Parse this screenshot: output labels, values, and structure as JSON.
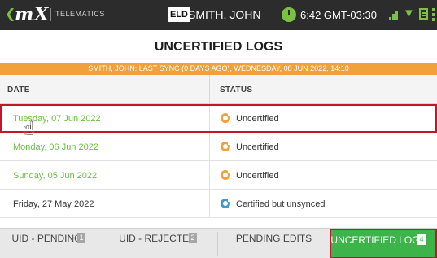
{
  "topbar": {
    "back_icon": "chevron-left-icon",
    "logo_m": "m",
    "logo_x": "X",
    "telematics": "TELEMATICS",
    "eld_badge": "ELD",
    "driver_name": "SMITH, JOHN",
    "time": "6:42 GMT-03:30",
    "icons": [
      "timer-icon",
      "signal-icon",
      "wifi-icon",
      "document-icon",
      "more-vert-icon"
    ],
    "accent_color": "#7bc143"
  },
  "title": "UNCERTIFIED LOGS",
  "sync_bar": "SMITH, JOHN: LAST SYNC (0 DAYS AGO), WEDNESDAY, 08 JUN 2022, 14:10",
  "table": {
    "headers": {
      "date": "DATE",
      "status": "STATUS"
    },
    "rows": [
      {
        "date": "Tuesday, 07 Jun 2022",
        "status": "Uncertified"
      },
      {
        "date": "Monday, 06 Jun 2022",
        "status": "Uncertified"
      },
      {
        "date": "Sunday, 05 Jun 2022",
        "status": "Uncertified"
      },
      {
        "date": "Friday, 27 May 2022",
        "status": "Certified but unsynced"
      }
    ]
  },
  "tabs": [
    {
      "label": "UID - PENDING",
      "count": "1"
    },
    {
      "label": "UID - REJECTED",
      "count": "2"
    },
    {
      "label": "PENDING EDITS",
      "count": ""
    },
    {
      "label": "UNCERTIFIED LOGS",
      "count": "4"
    }
  ],
  "colors": {
    "sync_bar": "#f0a13a",
    "uncertified_icon": "#f0a13a",
    "unsynced_icon": "#3d9ad1",
    "active_tab": "#3cb44a",
    "highlight_border": "#c3162a"
  }
}
